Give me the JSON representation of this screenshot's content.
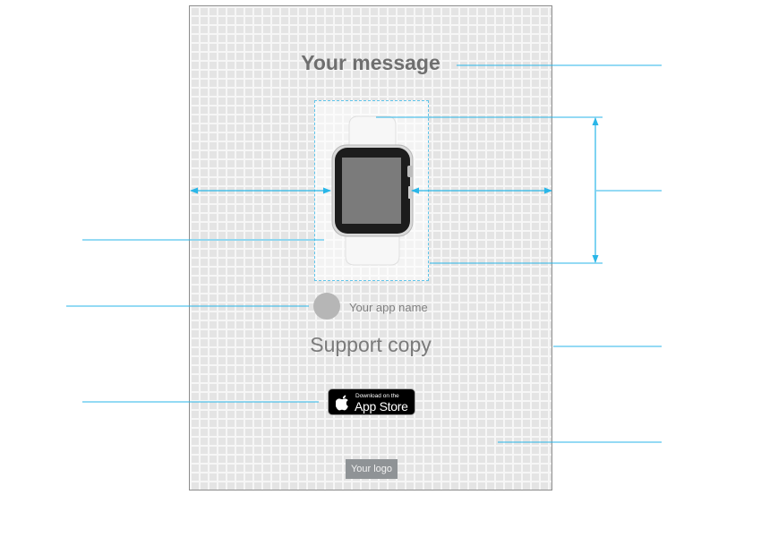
{
  "template": {
    "headline": "Your message",
    "app_name": "Your app name",
    "support_copy": "Support copy",
    "logo_label": "Your logo"
  },
  "badge": {
    "line1": "Download on the",
    "line2": "App Store"
  },
  "colors": {
    "guide_lines": "#29b6e8",
    "poster_border": "#8d8d8d",
    "grid_cell": "#e4e4e4",
    "grid_line": "#f6f6f6",
    "text_gray": "#6f6f6f",
    "logo_box": "#8f9396"
  }
}
